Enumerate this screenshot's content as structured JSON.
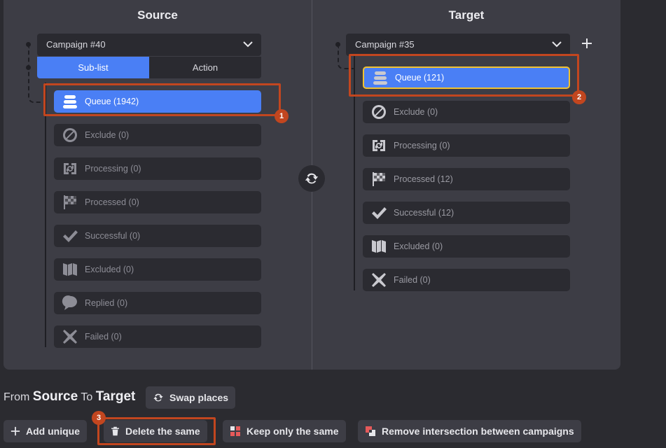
{
  "source": {
    "title": "Source",
    "campaign": "Campaign #40",
    "tabs": [
      "Sub-list",
      "Action"
    ],
    "items": [
      {
        "icon": "queue-icon",
        "label": "Queue (1942)"
      },
      {
        "icon": "exclude-icon",
        "label": "Exclude (0)"
      },
      {
        "icon": "processing-icon",
        "label": "Processing (0)"
      },
      {
        "icon": "checkered-flag-icon",
        "label": "Processed (0)"
      },
      {
        "icon": "checkmark-icon",
        "label": "Successful (0)"
      },
      {
        "icon": "excluded-map-icon",
        "label": "Excluded (0)"
      },
      {
        "icon": "chat-bubble-icon",
        "label": "Replied (0)"
      },
      {
        "icon": "x-icon",
        "label": "Failed (0)"
      }
    ]
  },
  "target": {
    "title": "Target",
    "campaign": "Campaign #35",
    "items": [
      {
        "icon": "queue-icon",
        "label": "Queue (121)"
      },
      {
        "icon": "exclude-icon",
        "label": "Exclude (0)"
      },
      {
        "icon": "processing-icon",
        "label": "Processing (0)"
      },
      {
        "icon": "checkered-flag-icon",
        "label": "Processed (12)"
      },
      {
        "icon": "checkmark-icon",
        "label": "Successful (12)"
      },
      {
        "icon": "excluded-map-icon",
        "label": "Excluded (0)"
      },
      {
        "icon": "x-icon",
        "label": "Failed (0)"
      }
    ]
  },
  "annotations": [
    "1",
    "2",
    "3"
  ],
  "bottom": {
    "from": "From",
    "source": "Source",
    "to": "To",
    "target": "Target",
    "swap_label": "Swap places",
    "buttons": {
      "add_unique": "Add unique",
      "delete_same": "Delete the same",
      "keep_same": "Keep only the same",
      "remove_intersection": "Remove intersection between campaigns"
    }
  },
  "colors": {
    "accent": "#4a7ff5",
    "highlight": "#c2461f",
    "selected_border": "#f1c232"
  }
}
